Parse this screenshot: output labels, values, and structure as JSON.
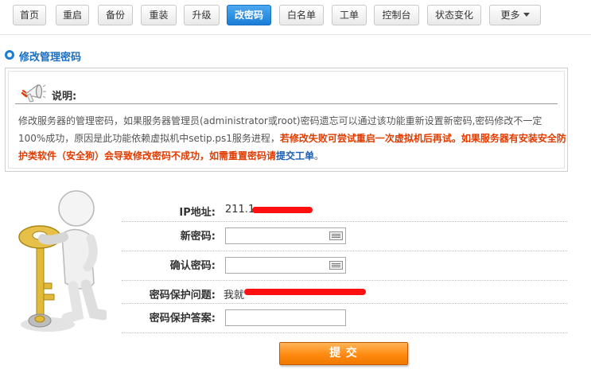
{
  "toolbar": {
    "buttons": [
      "首页",
      "重启",
      "备份",
      "重装",
      "升级",
      "改密码",
      "白名单",
      "工单",
      "控制台",
      "状态变化",
      "更多"
    ],
    "active": "改密码"
  },
  "section": {
    "title": "修改管理密码"
  },
  "note": {
    "heading": "说明:",
    "text_plain": "修改服务器的管理密码，如果服务器管理员(administrator或root)密码遗忘可以通过该功能重新设置新密码,密码修改不一定100%成功，原因是此功能依赖虚拟机中setip.ps1服务进程，",
    "text_red": "若修改失败可尝试重启一次虚拟机后再试。如果服务器有安装安全防护类软件（安全狗）会导致修改密码不成功，如需重置密码请",
    "link_text": "提交工单",
    "text_end": "。"
  },
  "form": {
    "ip_label": "IP地址:",
    "ip_value": "211.1",
    "new_pwd_label": "新密码:",
    "confirm_pwd_label": "确认密码:",
    "question_label": "密码保护问题:",
    "question_value": "我就",
    "answer_label": "密码保护答案:",
    "submit_label": "提 交"
  },
  "colors": {
    "active_tab": "#1a7ed8",
    "warning_text": "#e03c00",
    "link": "#1a5fb4",
    "submit": "#ff8a10",
    "redaction": "#ff1010"
  }
}
